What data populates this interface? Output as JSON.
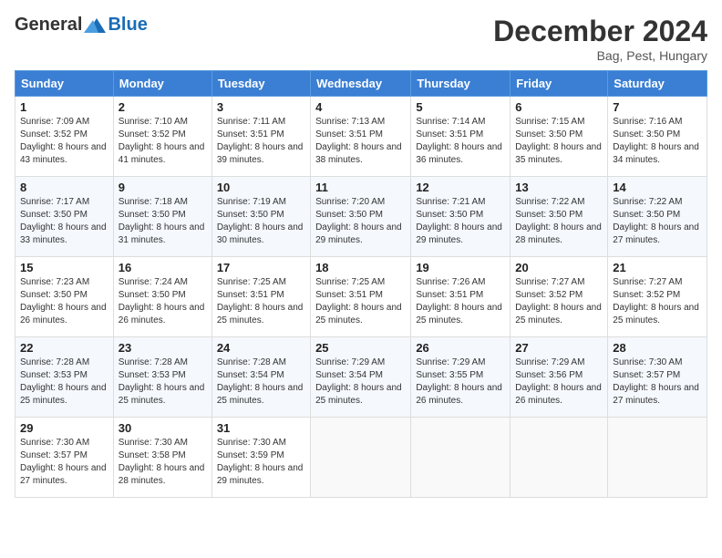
{
  "header": {
    "logo_general": "General",
    "logo_blue": "Blue",
    "month_title": "December 2024",
    "location": "Bag, Pest, Hungary"
  },
  "days_of_week": [
    "Sunday",
    "Monday",
    "Tuesday",
    "Wednesday",
    "Thursday",
    "Friday",
    "Saturday"
  ],
  "weeks": [
    [
      {
        "day": 1,
        "sunrise": "7:09 AM",
        "sunset": "3:52 PM",
        "daylight": "8 hours and 43 minutes."
      },
      {
        "day": 2,
        "sunrise": "7:10 AM",
        "sunset": "3:52 PM",
        "daylight": "8 hours and 41 minutes."
      },
      {
        "day": 3,
        "sunrise": "7:11 AM",
        "sunset": "3:51 PM",
        "daylight": "8 hours and 39 minutes."
      },
      {
        "day": 4,
        "sunrise": "7:13 AM",
        "sunset": "3:51 PM",
        "daylight": "8 hours and 38 minutes."
      },
      {
        "day": 5,
        "sunrise": "7:14 AM",
        "sunset": "3:51 PM",
        "daylight": "8 hours and 36 minutes."
      },
      {
        "day": 6,
        "sunrise": "7:15 AM",
        "sunset": "3:50 PM",
        "daylight": "8 hours and 35 minutes."
      },
      {
        "day": 7,
        "sunrise": "7:16 AM",
        "sunset": "3:50 PM",
        "daylight": "8 hours and 34 minutes."
      }
    ],
    [
      {
        "day": 8,
        "sunrise": "7:17 AM",
        "sunset": "3:50 PM",
        "daylight": "8 hours and 33 minutes."
      },
      {
        "day": 9,
        "sunrise": "7:18 AM",
        "sunset": "3:50 PM",
        "daylight": "8 hours and 31 minutes."
      },
      {
        "day": 10,
        "sunrise": "7:19 AM",
        "sunset": "3:50 PM",
        "daylight": "8 hours and 30 minutes."
      },
      {
        "day": 11,
        "sunrise": "7:20 AM",
        "sunset": "3:50 PM",
        "daylight": "8 hours and 29 minutes."
      },
      {
        "day": 12,
        "sunrise": "7:21 AM",
        "sunset": "3:50 PM",
        "daylight": "8 hours and 29 minutes."
      },
      {
        "day": 13,
        "sunrise": "7:22 AM",
        "sunset": "3:50 PM",
        "daylight": "8 hours and 28 minutes."
      },
      {
        "day": 14,
        "sunrise": "7:22 AM",
        "sunset": "3:50 PM",
        "daylight": "8 hours and 27 minutes."
      }
    ],
    [
      {
        "day": 15,
        "sunrise": "7:23 AM",
        "sunset": "3:50 PM",
        "daylight": "8 hours and 26 minutes."
      },
      {
        "day": 16,
        "sunrise": "7:24 AM",
        "sunset": "3:50 PM",
        "daylight": "8 hours and 26 minutes."
      },
      {
        "day": 17,
        "sunrise": "7:25 AM",
        "sunset": "3:51 PM",
        "daylight": "8 hours and 25 minutes."
      },
      {
        "day": 18,
        "sunrise": "7:25 AM",
        "sunset": "3:51 PM",
        "daylight": "8 hours and 25 minutes."
      },
      {
        "day": 19,
        "sunrise": "7:26 AM",
        "sunset": "3:51 PM",
        "daylight": "8 hours and 25 minutes."
      },
      {
        "day": 20,
        "sunrise": "7:27 AM",
        "sunset": "3:52 PM",
        "daylight": "8 hours and 25 minutes."
      },
      {
        "day": 21,
        "sunrise": "7:27 AM",
        "sunset": "3:52 PM",
        "daylight": "8 hours and 25 minutes."
      }
    ],
    [
      {
        "day": 22,
        "sunrise": "7:28 AM",
        "sunset": "3:53 PM",
        "daylight": "8 hours and 25 minutes."
      },
      {
        "day": 23,
        "sunrise": "7:28 AM",
        "sunset": "3:53 PM",
        "daylight": "8 hours and 25 minutes."
      },
      {
        "day": 24,
        "sunrise": "7:28 AM",
        "sunset": "3:54 PM",
        "daylight": "8 hours and 25 minutes."
      },
      {
        "day": 25,
        "sunrise": "7:29 AM",
        "sunset": "3:54 PM",
        "daylight": "8 hours and 25 minutes."
      },
      {
        "day": 26,
        "sunrise": "7:29 AM",
        "sunset": "3:55 PM",
        "daylight": "8 hours and 26 minutes."
      },
      {
        "day": 27,
        "sunrise": "7:29 AM",
        "sunset": "3:56 PM",
        "daylight": "8 hours and 26 minutes."
      },
      {
        "day": 28,
        "sunrise": "7:30 AM",
        "sunset": "3:57 PM",
        "daylight": "8 hours and 27 minutes."
      }
    ],
    [
      {
        "day": 29,
        "sunrise": "7:30 AM",
        "sunset": "3:57 PM",
        "daylight": "8 hours and 27 minutes."
      },
      {
        "day": 30,
        "sunrise": "7:30 AM",
        "sunset": "3:58 PM",
        "daylight": "8 hours and 28 minutes."
      },
      {
        "day": 31,
        "sunrise": "7:30 AM",
        "sunset": "3:59 PM",
        "daylight": "8 hours and 29 minutes."
      },
      null,
      null,
      null,
      null
    ]
  ]
}
